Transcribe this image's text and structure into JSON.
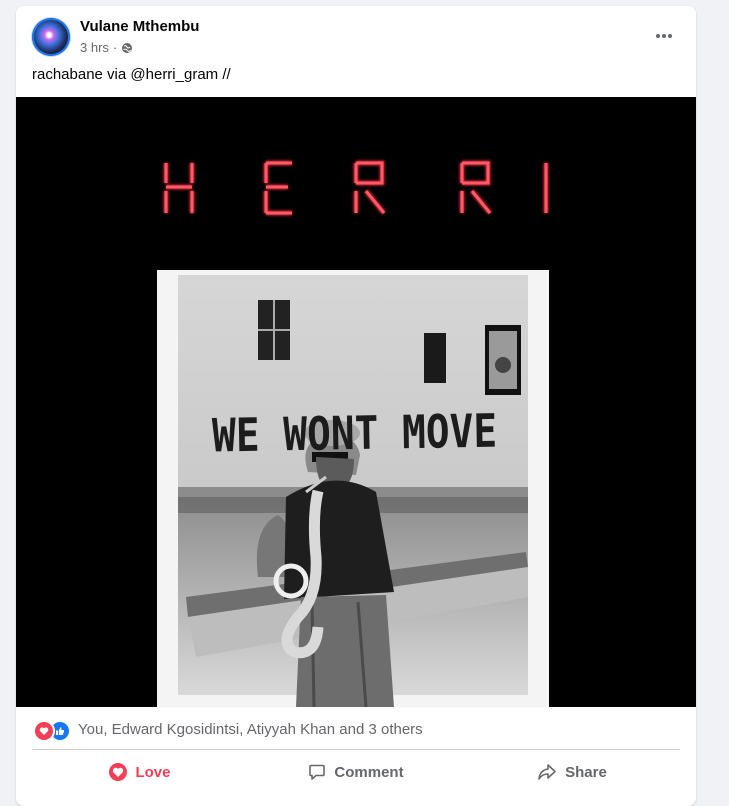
{
  "post": {
    "author": "Vulane Mthembu",
    "time": "3 hrs",
    "separator": "·",
    "caption": "rachabane via @herri_gram //"
  },
  "image": {
    "headline": "HERRI",
    "wall_text": "WE WONT MOVE"
  },
  "reactions": {
    "summary": "You, Edward Kgosidintsi, Atiyyah Khan and 3 others",
    "icons": [
      "love-icon",
      "like-icon"
    ]
  },
  "actions": {
    "love": "Love",
    "comment": "Comment",
    "share": "Share"
  },
  "colors": {
    "love": "#f33e58",
    "like": "#1877f2",
    "neon": "#e8283c",
    "muted": "#65676b"
  }
}
